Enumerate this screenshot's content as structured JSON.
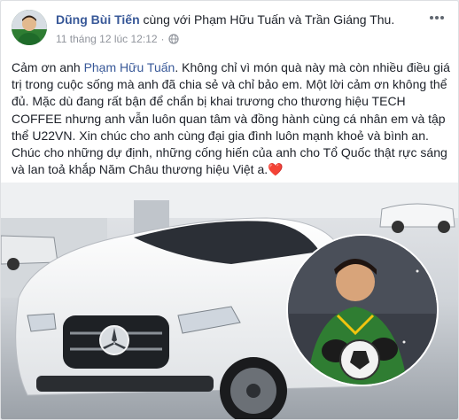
{
  "post": {
    "author": "Dũng Bùi Tiến",
    "with_text": "cùng với",
    "tagged_1": "Phạm Hữu Tuấn",
    "and_text": "và",
    "tagged_2": "Trần Giáng Thu.",
    "timestamp": "11 tháng 12 lúc 12:12",
    "audience_icon": "globe-icon",
    "more_icon": "more-dots-icon",
    "text_part1": "Cảm ơn anh ",
    "text_mention": "Phạm Hữu Tuấn",
    "text_part2": ". Không chỉ vì món quà này mà còn nhiều điều giá trị trong cuộc sống mà anh đã chia sẻ và chỉ bảo em. Một lời cảm ơn không thể đủ. Mặc dù đang rất bận để chẩn bị khai trương cho thương hiệu TECH COFFEE nhưng anh vẫn luôn quan tâm và đồng hành cùng cá nhân em và tập thể U22VN. Xin chúc cho anh cùng đại gia đình luôn mạnh khoẻ và bình an. Chúc cho những dự định, những cống hiến của anh cho Tổ Quốc thật rực sáng và lan toả khắp Năm Châu thương hiệu Việt a.",
    "heart_glyph": "❤️"
  },
  "photo": {
    "car_badge_icon": "mercedes-star-icon"
  },
  "colors": {
    "link": "#385898",
    "text": "#1d2129",
    "meta": "#90949c",
    "car_white": "#f4f5f6",
    "jersey_green": "#2f7d32"
  }
}
